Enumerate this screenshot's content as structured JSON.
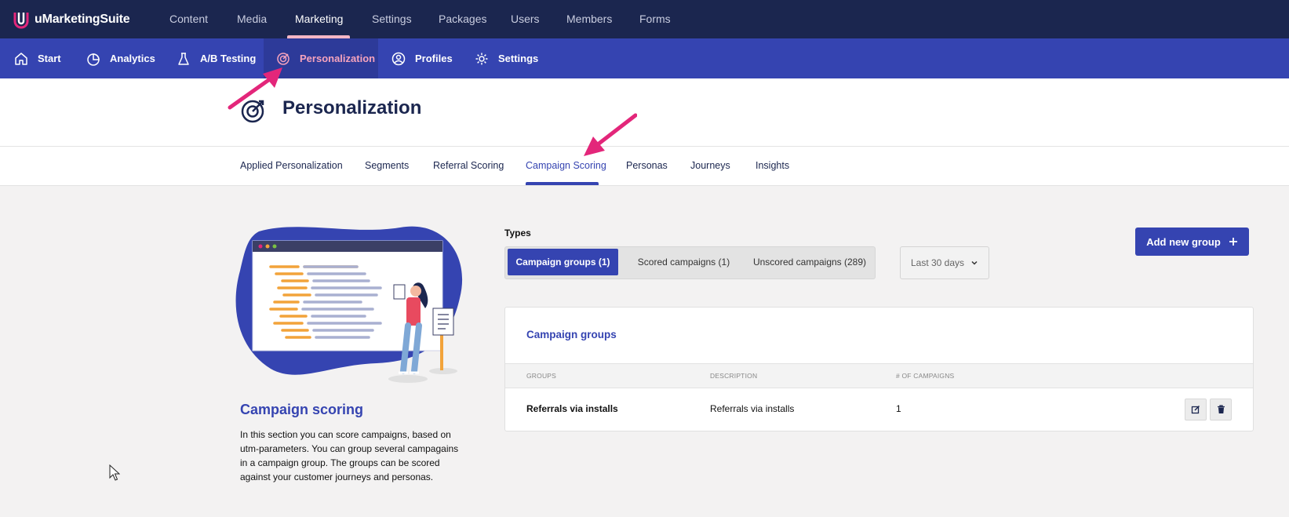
{
  "app": {
    "name": "uMarketingSuite"
  },
  "top_nav": [
    {
      "label": "Content"
    },
    {
      "label": "Media"
    },
    {
      "label": "Marketing"
    },
    {
      "label": "Settings"
    },
    {
      "label": "Packages"
    },
    {
      "label": "Users"
    },
    {
      "label": "Members"
    },
    {
      "label": "Forms"
    }
  ],
  "top_nav_active": "Marketing",
  "sub_nav": [
    {
      "label": "Start",
      "icon": "home-icon"
    },
    {
      "label": "Analytics",
      "icon": "pie-chart-icon"
    },
    {
      "label": "A/B Testing",
      "icon": "flask-icon"
    },
    {
      "label": "Personalization",
      "icon": "target-icon"
    },
    {
      "label": "Profiles",
      "icon": "user-circle-icon"
    },
    {
      "label": "Settings",
      "icon": "gear-icon"
    }
  ],
  "sub_nav_active": "Personalization",
  "page": {
    "title": "Personalization"
  },
  "tabs": [
    {
      "label": "Applied Personalization"
    },
    {
      "label": "Segments"
    },
    {
      "label": "Referral Scoring"
    },
    {
      "label": "Campaign Scoring"
    },
    {
      "label": "Personas"
    },
    {
      "label": "Journeys"
    },
    {
      "label": "Insights"
    }
  ],
  "tabs_active": "Campaign Scoring",
  "intro": {
    "title": "Campaign scoring",
    "description": "In this section you can score campaigns, based on utm-parameters. You can group several campagains in a campaign group. The groups can be scored against your customer journeys and personas."
  },
  "types": {
    "label": "Types",
    "options": [
      "Campaign groups (1)",
      "Scored campaigns (1)",
      "Unscored campaigns (289)"
    ],
    "selected": "Campaign groups (1)"
  },
  "date_filter": {
    "value": "Last 30 days"
  },
  "add_button": {
    "label": "Add new group"
  },
  "table": {
    "title": "Campaign groups",
    "columns": [
      "Groups",
      "Description",
      "# of campaigns"
    ],
    "rows": [
      {
        "group": "Referrals via installs",
        "description": "Referrals via installs",
        "campaigns": "1"
      }
    ]
  },
  "colors": {
    "topbar": "#1b264f",
    "subbar": "#3544b1",
    "accent_pink": "#e3267a",
    "active_tab_text": "#f5a3bd"
  }
}
